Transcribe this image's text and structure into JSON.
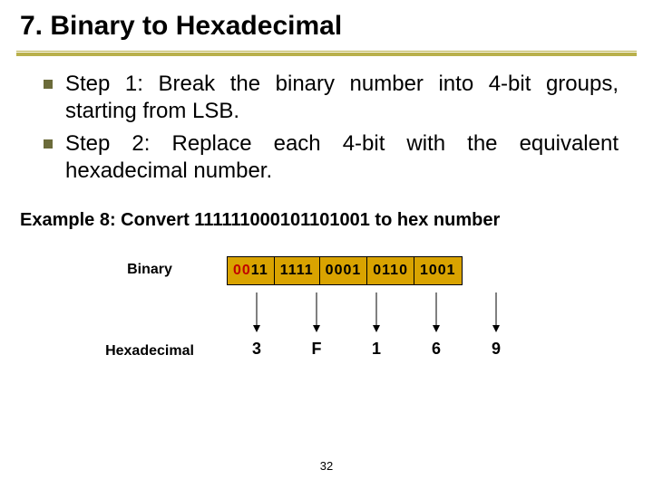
{
  "title": "7. Binary to Hexadecimal",
  "bullets": [
    "Step 1: Break the binary number into 4-bit groups, starting from LSB.",
    "Step 2: Replace each 4-bit with the equivalent hexadecimal number."
  ],
  "example_label": "Example 8: Convert 111111000101101001 to hex number",
  "row_labels": {
    "binary": "Binary",
    "hex": "Hexadecimal"
  },
  "binary_groups": [
    {
      "pad": "00",
      "bits": "11"
    },
    {
      "pad": "",
      "bits": "1111"
    },
    {
      "pad": "",
      "bits": "0001"
    },
    {
      "pad": "",
      "bits": "0110"
    },
    {
      "pad": "",
      "bits": "1001"
    }
  ],
  "hex_values": [
    "3",
    "F",
    "1",
    "6",
    "9"
  ],
  "page_number": "32"
}
